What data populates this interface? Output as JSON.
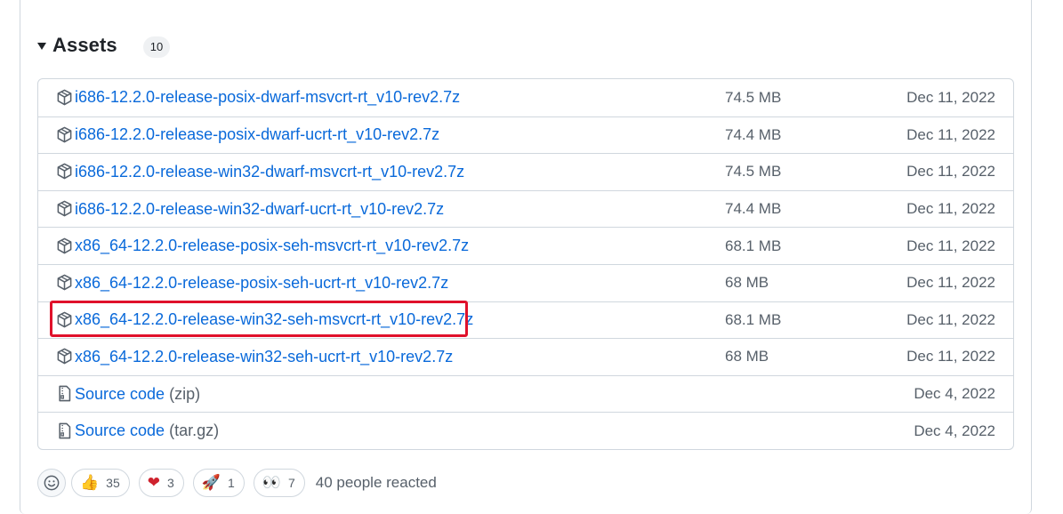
{
  "assets": {
    "title": "Assets",
    "count": "10",
    "items": [
      {
        "icon": "package-icon",
        "name": "i686-12.2.0-release-posix-dwarf-msvcrt-rt_v10-rev2.7z",
        "suffix": "",
        "size": "74.5 MB",
        "date": "Dec 11, 2022"
      },
      {
        "icon": "package-icon",
        "name": "i686-12.2.0-release-posix-dwarf-ucrt-rt_v10-rev2.7z",
        "suffix": "",
        "size": "74.4 MB",
        "date": "Dec 11, 2022"
      },
      {
        "icon": "package-icon",
        "name": "i686-12.2.0-release-win32-dwarf-msvcrt-rt_v10-rev2.7z",
        "suffix": "",
        "size": "74.5 MB",
        "date": "Dec 11, 2022"
      },
      {
        "icon": "package-icon",
        "name": "i686-12.2.0-release-win32-dwarf-ucrt-rt_v10-rev2.7z",
        "suffix": "",
        "size": "74.4 MB",
        "date": "Dec 11, 2022"
      },
      {
        "icon": "package-icon",
        "name": "x86_64-12.2.0-release-posix-seh-msvcrt-rt_v10-rev2.7z",
        "suffix": "",
        "size": "68.1 MB",
        "date": "Dec 11, 2022"
      },
      {
        "icon": "package-icon",
        "name": "x86_64-12.2.0-release-posix-seh-ucrt-rt_v10-rev2.7z",
        "suffix": "",
        "size": "68 MB",
        "date": "Dec 11, 2022"
      },
      {
        "icon": "package-icon",
        "name": "x86_64-12.2.0-release-win32-seh-msvcrt-rt_v10-rev2.7z",
        "suffix": "",
        "size": "68.1 MB",
        "date": "Dec 11, 2022"
      },
      {
        "icon": "package-icon",
        "name": "x86_64-12.2.0-release-win32-seh-ucrt-rt_v10-rev2.7z",
        "suffix": "",
        "size": "68 MB",
        "date": "Dec 11, 2022"
      },
      {
        "icon": "file-zip-icon",
        "name": "Source code",
        "suffix": "(zip)",
        "size": "",
        "date": "Dec 4, 2022"
      },
      {
        "icon": "file-zip-icon",
        "name": "Source code",
        "suffix": "(tar.gz)",
        "size": "",
        "date": "Dec 4, 2022"
      }
    ]
  },
  "reactions": {
    "items": [
      {
        "name": "thumbs-up",
        "emoji": "👍",
        "count": "35"
      },
      {
        "name": "heart",
        "emoji": "❤",
        "count": "3"
      },
      {
        "name": "rocket",
        "emoji": "🚀",
        "count": "1"
      },
      {
        "name": "eyes",
        "emoji": "👀",
        "count": "7"
      }
    ],
    "summary": "40 people reacted"
  },
  "colors": {
    "link": "#0969da",
    "muted": "#57606a",
    "border": "#d0d7de",
    "highlight": "#e0112b"
  }
}
